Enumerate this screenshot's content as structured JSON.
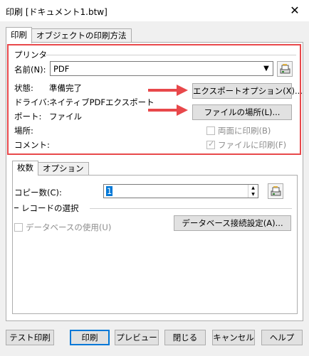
{
  "window": {
    "title": "印刷 [ドキュメント1.btw]",
    "close_glyph": "✕"
  },
  "tabs": {
    "print": "印刷",
    "object_print": "オブジェクトの印刷方法"
  },
  "printer": {
    "group_title": "プリンタ",
    "name_label": "名前(N):",
    "name_value": "PDF",
    "status_label": "状態:",
    "status_value": "準備完了",
    "driver_label": "ドライバ:",
    "driver_value": "ネイティブPDFエクスポート",
    "port_label": "ポート:",
    "port_value": "ファイル",
    "location_label": "場所:",
    "comment_label": "コメント:",
    "export_options_button": "エクスポートオプション(X)...",
    "file_location_button": "ファイルの場所(L)...",
    "duplex_checkbox": "両面に印刷(B)",
    "print_to_file_checkbox": "ファイルに印刷(F)"
  },
  "inner_tabs": {
    "copies": "枚数",
    "options": "オプション"
  },
  "copies": {
    "label": "コピー数(C):",
    "value": "1",
    "record_selection_title": "レコードの選択",
    "use_database_checkbox": "データベースの使用(U)",
    "db_connection_button": "データベース接続設定(A)..."
  },
  "footer": {
    "test_print": "テスト印刷",
    "print": "印刷",
    "preview": "プレビュー",
    "close": "閉じる",
    "cancel": "キャンセル",
    "help": "ヘルプ"
  },
  "colors": {
    "highlight": "#e8484b",
    "arrow": "#e8484b",
    "accent": "#0078d7"
  }
}
